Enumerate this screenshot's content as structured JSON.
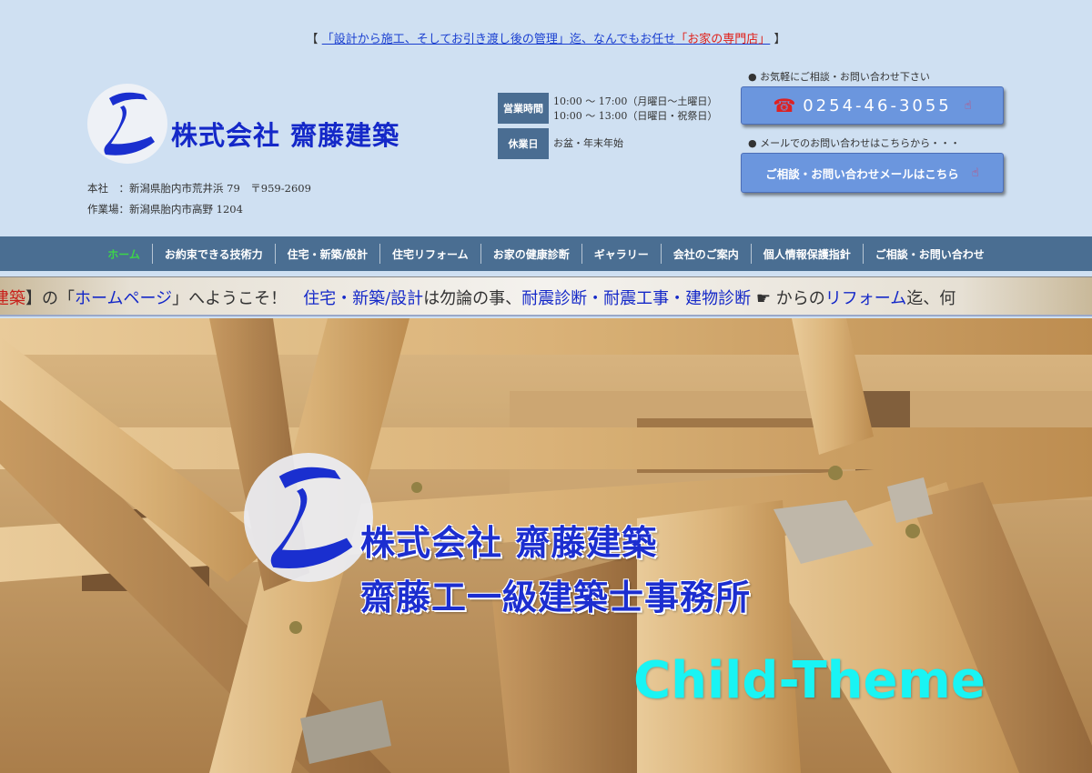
{
  "tagline": {
    "open": "【",
    "link_before": "「設計から施工、そしてお引き渡し後の管理」迄、なんでもお任せ",
    "link_highlight": "「お家の専門店」",
    "close": "】"
  },
  "logo": {
    "name": "株式会社 齋藤建築"
  },
  "address": {
    "head_office": "本社　：新潟県胎内市荒井浜 79　〒959-2609",
    "workshop": "作業場：新潟県胎内市高野 1204"
  },
  "hours": {
    "business_label": "営業時間",
    "weekday": "10:00 ～ 17:00（月曜日～土曜日）",
    "holiday": "10:00 ～ 13:00（日曜日・祝祭日）",
    "closed_label": "休業日",
    "closed_text": "お盆・年末年始"
  },
  "contact": {
    "phone_note": "● お気軽にご相談・お問い合わせ下さい",
    "phone_number": "0254-46-3055",
    "mail_note": "● メールでのお問い合わせはこちらから・・・",
    "mail_label": "ご相談・お問い合わせメールはこちら"
  },
  "icons": {
    "phone": "☎",
    "pointer": "☝"
  },
  "nav": {
    "items": [
      {
        "label": "ホーム"
      },
      {
        "label": "お約束できる技術力"
      },
      {
        "label": "住宅・新築/設計"
      },
      {
        "label": "住宅リフォーム"
      },
      {
        "label": "お家の健康診断"
      },
      {
        "label": "ギャラリー"
      },
      {
        "label": "会社のご案内"
      },
      {
        "label": "個人情報保護指針"
      },
      {
        "label": "ご相談・お問い合わせ"
      }
    ]
  },
  "marquee": {
    "p1": "建築",
    "p2": "】の「",
    "p3": "ホームページ",
    "p4": "」へようこそ！　",
    "p5": "住宅・新築/設計",
    "p6": "は勿論の事、",
    "p7": "耐震診断・耐震工事・建物診断",
    "p8": " ☛ からの",
    "p9": "リフォーム",
    "p10": "迄、何"
  },
  "hero": {
    "line1": "株式会社 齋藤建築",
    "line2": "齋藤工一級建築士事務所",
    "child_theme": "Child-Theme"
  },
  "colors": {
    "page_bg": "#cfe0f2",
    "brand_blue": "#1428c8",
    "nav_bg": "#4a6e92",
    "nav_active": "#3dd44a",
    "button_blue": "#6b96de",
    "accent_cyan": "#19f4f4",
    "accent_red": "#e0201a"
  }
}
